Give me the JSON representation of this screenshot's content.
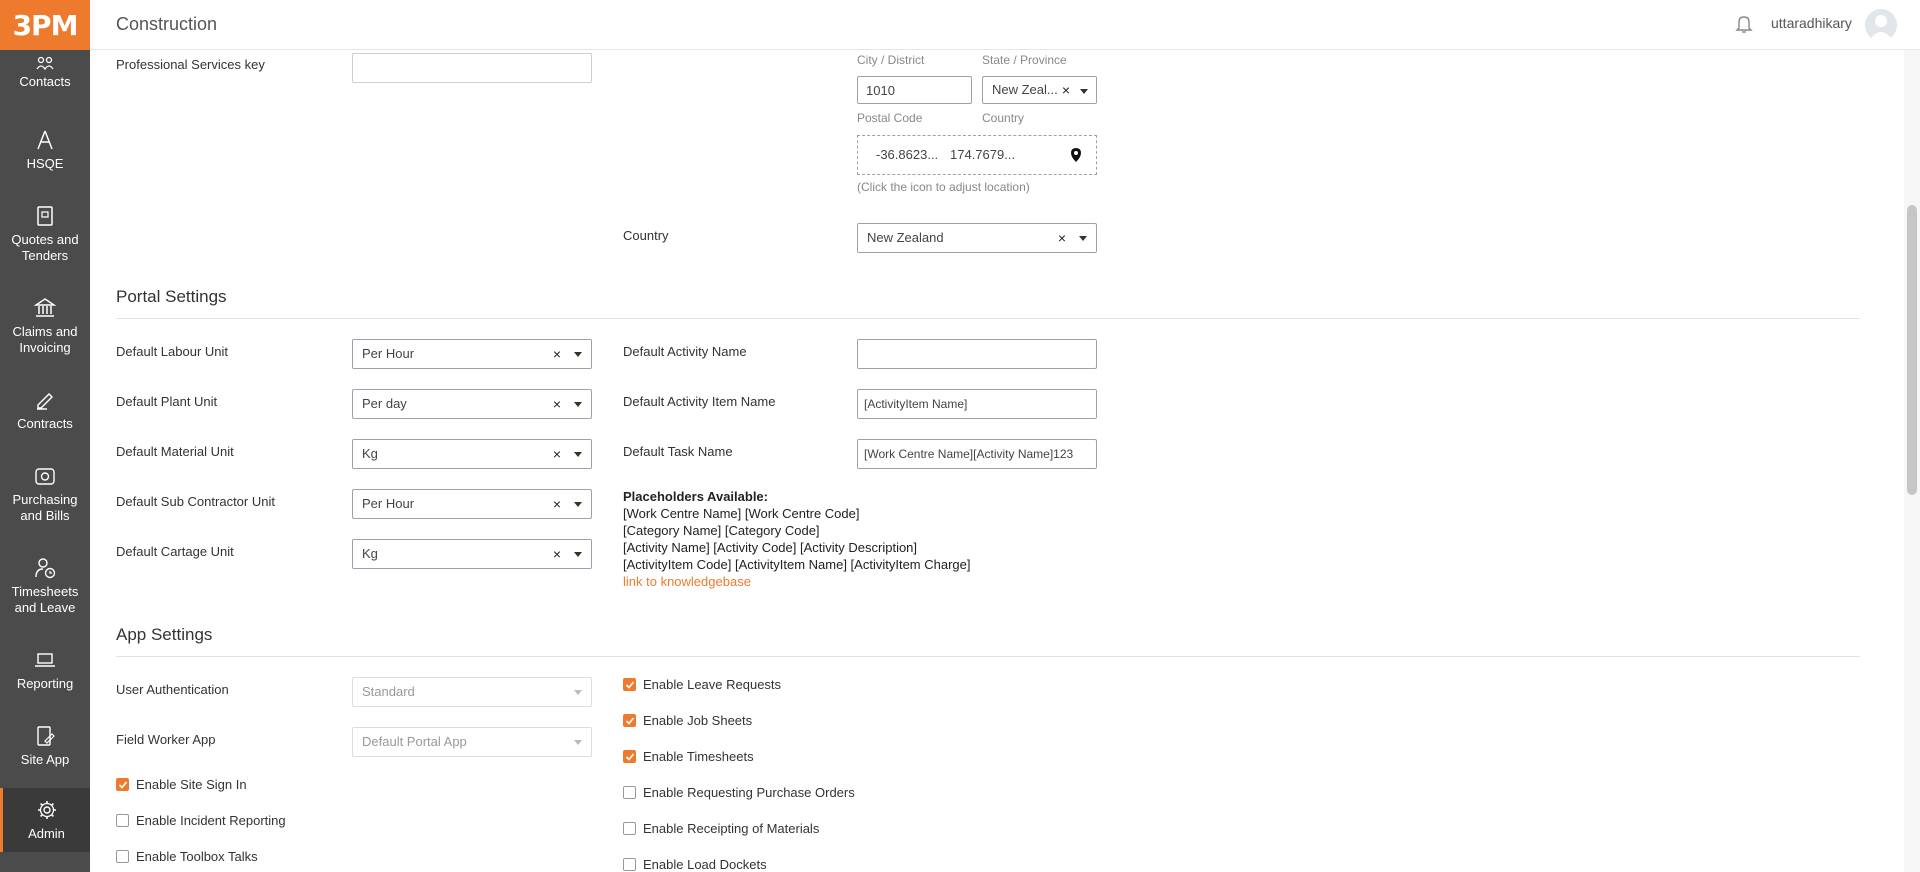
{
  "app": {
    "logo": "3PM",
    "title": "Construction"
  },
  "header": {
    "username": "uttaradhikary"
  },
  "sidebar": {
    "items": [
      {
        "label": "Contacts",
        "icon": "contacts-icon"
      },
      {
        "label": "HSQE",
        "icon": "hsqe-icon"
      },
      {
        "label": "Quotes and Tenders",
        "icon": "quotes-icon"
      },
      {
        "label": "Claims and Invoicing",
        "icon": "bank-icon"
      },
      {
        "label": "Contracts",
        "icon": "pen-icon"
      },
      {
        "label": "Purchasing and Bills",
        "icon": "eye-icon"
      },
      {
        "label": "Timesheets and Leave",
        "icon": "timesheet-icon"
      },
      {
        "label": "Reporting",
        "icon": "laptop-icon"
      },
      {
        "label": "Site App",
        "icon": "site-app-icon"
      },
      {
        "label": "Admin",
        "icon": "gear-icon"
      }
    ]
  },
  "top": {
    "professional_services_label": "Professional Services key",
    "professional_services_value": "",
    "city_label": "City / District",
    "state_label": "State / Province",
    "postal_code_value": "1010",
    "state_value": "New Zeal...",
    "postal_code_label": "Postal Code",
    "country_small_label": "Country",
    "lat": "-36.8623...",
    "lng": "174.7679...",
    "location_hint": "(Click the icon to adjust location)",
    "country_label": "Country",
    "country_value": "New Zealand"
  },
  "portal": {
    "title": "Portal Settings",
    "labour_label": "Default Labour Unit",
    "labour_value": "Per Hour",
    "plant_label": "Default Plant Unit",
    "plant_value": "Per day",
    "material_label": "Default Material Unit",
    "material_value": "Kg",
    "subcontractor_label": "Default Sub Contractor Unit",
    "subcontractor_value": "Per Hour",
    "cartage_label": "Default Cartage Unit",
    "cartage_value": "Kg",
    "activity_name_label": "Default Activity Name",
    "activity_name_value": "",
    "activity_item_label": "Default Activity Item Name",
    "activity_item_value": "[ActivityItem Name]",
    "task_name_label": "Default Task Name",
    "task_name_value": "[Work Centre Name][Activity Name]123",
    "placeholders_heading": "Placeholders Available:",
    "placeholders_lines": [
      "[Work Centre Name] [Work Centre Code]",
      "[Category Name] [Category Code]",
      "[Activity Name] [Activity Code] [Activity Description]",
      "[ActivityItem Code] [ActivityItem Name] [ActivityItem Charge]"
    ],
    "kb_link": "link to knowledgebase"
  },
  "app_settings": {
    "title": "App Settings",
    "auth_label": "User Authentication",
    "auth_value": "Standard",
    "field_app_label": "Field Worker App",
    "field_app_value": "Default Portal App",
    "left_checks": [
      {
        "label": "Enable Site Sign In",
        "checked": true
      },
      {
        "label": "Enable Incident Reporting",
        "checked": false
      },
      {
        "label": "Enable Toolbox Talks",
        "checked": false
      }
    ],
    "right_checks": [
      {
        "label": "Enable Leave Requests",
        "checked": true
      },
      {
        "label": "Enable Job Sheets",
        "checked": true
      },
      {
        "label": "Enable Timesheets",
        "checked": true
      },
      {
        "label": "Enable Requesting Purchase Orders",
        "checked": false
      },
      {
        "label": "Enable Receipting of Materials",
        "checked": false
      },
      {
        "label": "Enable Load Dockets",
        "checked": false
      }
    ]
  },
  "colors": {
    "accent": "#ee7a2e",
    "sidebar": "#4b4b4b"
  }
}
